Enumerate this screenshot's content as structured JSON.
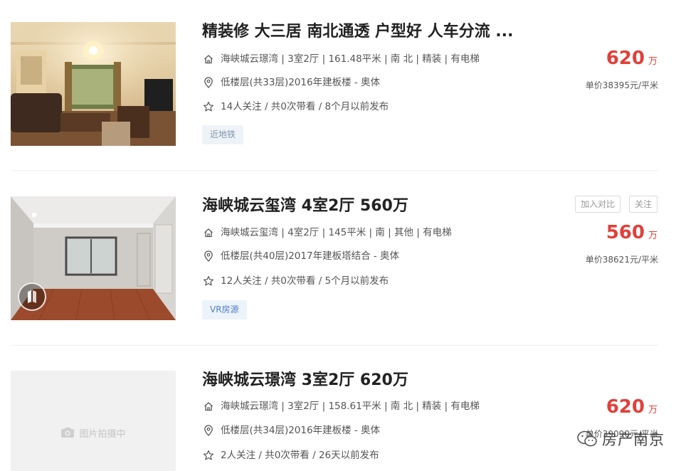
{
  "listings": [
    {
      "title": "精装修 大三居 南北通透 户型好 人车分流 ...",
      "info": "海峡城云璟湾 | 3室2厅 | 161.48平米 | 南 北 | 精装 | 有电梯",
      "floor": "低楼层(共33层)2016年建板楼 - 奥体",
      "follow": "14人关注 / 共0次带看 / 8个月以前发布",
      "tag": "近地铁",
      "price": "620",
      "price_unit": "万",
      "unit_price": "单价38395元/平米"
    },
    {
      "title": "海峡城云玺湾 4室2厅 560万",
      "info": "海峡城云玺湾 | 4室2厅 | 145平米 | 南 | 其他 | 有电梯",
      "floor": "低楼层(共40层)2017年建板塔结合 - 奥体",
      "follow": "12人关注 / 共0次带看 / 5个月以前发布",
      "tag": "VR房源",
      "price": "560",
      "price_unit": "万",
      "unit_price": "单价38621元/平米",
      "compare_label": "加入对比",
      "follow_label": "关注"
    },
    {
      "title": "海峡城云璟湾 3室2厅 620万",
      "info": "海峡城云璟湾 | 3室2厅 | 158.61平米 | 南 北 | 精装 | 有电梯",
      "floor": "低楼层(共34层)2016年建板楼 - 奥体",
      "follow": "2人关注 / 共0次带看 / 26天以前发布",
      "price": "620",
      "price_unit": "万",
      "unit_price": "单价39090元/平米",
      "photo_placeholder": "图片拍摄中"
    }
  ],
  "watermark": {
    "text": "房产南京"
  },
  "icons": {
    "community": "home-icon",
    "location": "location-pin-icon",
    "follow": "star-icon",
    "vr": "vr-badge-icon",
    "camera": "camera-icon"
  },
  "colors": {
    "price": "#e0413b",
    "tag_bg": "#eef3f8",
    "vr_tag_text": "#4d7fc4"
  }
}
